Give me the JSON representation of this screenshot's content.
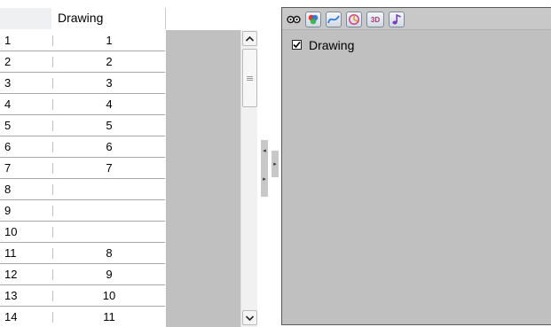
{
  "xsheet": {
    "column_header": "Drawing",
    "rows": [
      {
        "frame": "1",
        "drawing": "1"
      },
      {
        "frame": "2",
        "drawing": "2"
      },
      {
        "frame": "3",
        "drawing": "3"
      },
      {
        "frame": "4",
        "drawing": "4"
      },
      {
        "frame": "5",
        "drawing": "5"
      },
      {
        "frame": "6",
        "drawing": "6"
      },
      {
        "frame": "7",
        "drawing": "7"
      },
      {
        "frame": "8",
        "drawing": ""
      },
      {
        "frame": "9",
        "drawing": ""
      },
      {
        "frame": "10",
        "drawing": ""
      },
      {
        "frame": "11",
        "drawing": "8"
      },
      {
        "frame": "12",
        "drawing": "9"
      },
      {
        "frame": "13",
        "drawing": "10"
      },
      {
        "frame": "14",
        "drawing": "11"
      }
    ]
  },
  "timeline": {
    "toolbar_icons": [
      "show-all-icon",
      "color-icon",
      "curve-icon",
      "effect-icon",
      "3d-icon",
      "sound-icon"
    ],
    "toolbar_3d_label": "3D",
    "layer": {
      "name": "Drawing",
      "checked": true
    }
  }
}
